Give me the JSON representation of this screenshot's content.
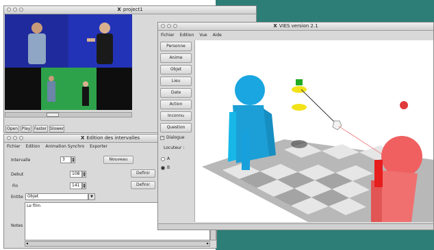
{
  "project_window": {
    "title": "project1",
    "controls": [
      "Open",
      "Play",
      "Faster",
      "Slower"
    ]
  },
  "intervals_window": {
    "title": "Edition des intervalles",
    "menu": [
      "Fichier",
      "Edition",
      "Animation Synchro",
      "Exporter"
    ],
    "intervalle_label": "Intervalle",
    "intervalle_value": "3",
    "nouveau_label": "Nouveau",
    "debut_label": "Debut",
    "debut_value": "108",
    "fin_label": "Fin",
    "fin_value": "141",
    "definir_label": "Definir",
    "entite_label": "Entite",
    "entite_value": "Objet",
    "text_content": "Le film",
    "notes_label": "Notes"
  },
  "vies_window": {
    "title": "VIES version 2.1",
    "menu": [
      "Fichier",
      "Edition",
      "Vue",
      "Aide"
    ],
    "tools": [
      "Personne",
      "Anime",
      "Objet",
      "Lieu",
      "Date",
      "Action",
      "Inconnu",
      "Question"
    ],
    "dialogue_label": "Dialogue",
    "locuteur_label": "Locuteur :",
    "radio_a": "A",
    "radio_b": "B"
  },
  "colors": {
    "teal_background": "#2d7e77",
    "person_blue": "#1aa6e0",
    "person_red": "#f06060",
    "object_yellow": "#f2e21a",
    "object_green": "#22aa22"
  }
}
